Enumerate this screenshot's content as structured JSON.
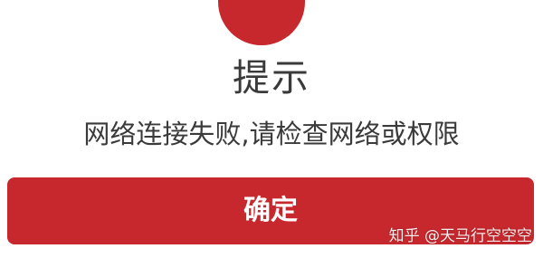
{
  "dialog": {
    "icon": "error-wifi-icon",
    "title": "提示",
    "message": "网络连接失败,请检查网络或权限",
    "confirm_label": "确定"
  },
  "watermark": {
    "text": "知乎 @天马行空空空"
  },
  "colors": {
    "accent": "#c6282d",
    "text": "#3a3a3a",
    "background": "#ffffff"
  }
}
